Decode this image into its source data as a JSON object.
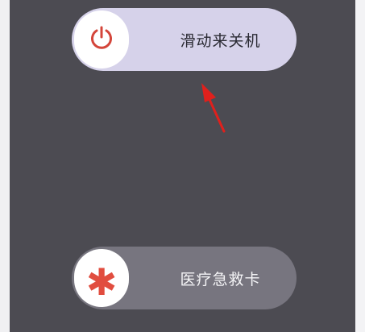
{
  "power_slider": {
    "label": "滑动来关机",
    "icon": "power-icon"
  },
  "medical_slider": {
    "label": "医疗急救卡",
    "icon": "asterisk-icon",
    "icon_glyph": "✱"
  },
  "annotation": {
    "icon": "red-arrow-icon"
  },
  "colors": {
    "background": "#4c4b52",
    "power_track": "#d6d2ea",
    "medical_track": "#77757f",
    "accent_red": "#e14d3f"
  }
}
